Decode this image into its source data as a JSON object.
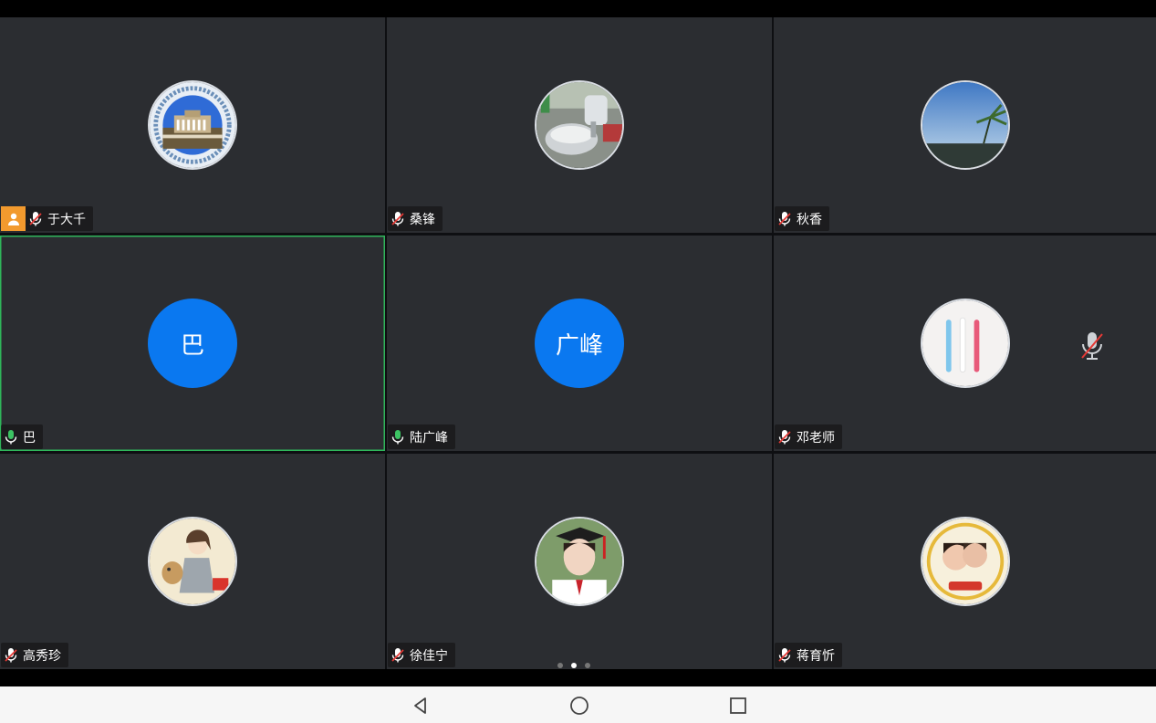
{
  "participants": [
    {
      "name": "于大千",
      "host": true,
      "mic": "muted",
      "avatar": "campus-building-photo-icon"
    },
    {
      "name": "桑锋",
      "host": false,
      "mic": "muted",
      "avatar": "kitchen-mixer-photo-icon"
    },
    {
      "name": "秋香",
      "host": false,
      "mic": "muted",
      "avatar": "sky-palm-photo-icon"
    },
    {
      "name": "巴",
      "host": false,
      "mic": "on",
      "avatar_initial": "巴",
      "active": true
    },
    {
      "name": "陆广峰",
      "host": false,
      "mic": "on",
      "avatar_initial": "广峰"
    },
    {
      "name": "邓老师",
      "host": false,
      "mic": "muted",
      "avatar": "chalk-sticks-photo-icon"
    },
    {
      "name": "高秀珍",
      "host": false,
      "mic": "muted",
      "avatar": "anime-girl-dog-photo-icon"
    },
    {
      "name": "徐佳宁",
      "host": false,
      "mic": "muted",
      "avatar": "graduate-girl-photo-icon"
    },
    {
      "name": "蒋育忻",
      "host": false,
      "mic": "muted",
      "avatar": "two-kids-badge-photo-icon"
    }
  ],
  "pager": {
    "pages": 3,
    "current": 2
  },
  "navbar": [
    "back-icon",
    "home-icon",
    "recents-icon"
  ],
  "colors": {
    "tile_bg": "#2b2d31",
    "initial_avatar_bg": "#0a78f0",
    "host_badge": "#f29a2e",
    "mic_on": "#3cc463",
    "mic_muted": "#e53935",
    "active_border": "#2fb55a"
  }
}
